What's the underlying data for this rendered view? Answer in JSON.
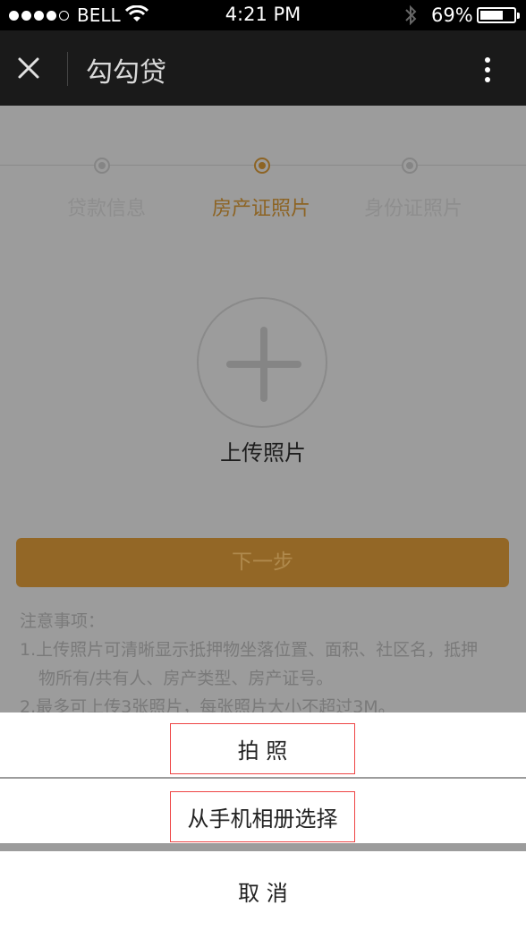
{
  "status_bar": {
    "carrier": "BELL",
    "time": "4:21 PM",
    "battery_percent": "69%",
    "battery_level": 0.69,
    "signal_bars_filled": 4,
    "signal_bars_total": 5
  },
  "nav": {
    "title": "勾勾贷",
    "close_icon": "close-icon",
    "more_icon": "more-vertical-icon"
  },
  "steps": [
    {
      "label": "贷款信息",
      "active": false
    },
    {
      "label": "房产证照片",
      "active": true
    },
    {
      "label": "身份证照片",
      "active": false
    }
  ],
  "upload": {
    "label": "上传照片",
    "icon": "plus-icon"
  },
  "next_button": "下一步",
  "notes": {
    "heading": "注意事项：",
    "item1_line1": "1.上传照片可清晰显示抵押物坐落位置、面积、社区名，抵押",
    "item1_line2": "物所有/共有人、房产类型、房产证号。",
    "item2": "2.最多可上传3张照片，每张照片大小不超过3M。"
  },
  "action_sheet": {
    "take_photo": "拍 照",
    "choose_from_album": "从手机相册选择",
    "cancel": "取 消"
  },
  "colors": {
    "accent": "#8d6424",
    "button": "#936726",
    "overlay_bg": "#9c9c9c",
    "nav_bg": "#1a1a1a",
    "highlight_border": "#e44444"
  }
}
